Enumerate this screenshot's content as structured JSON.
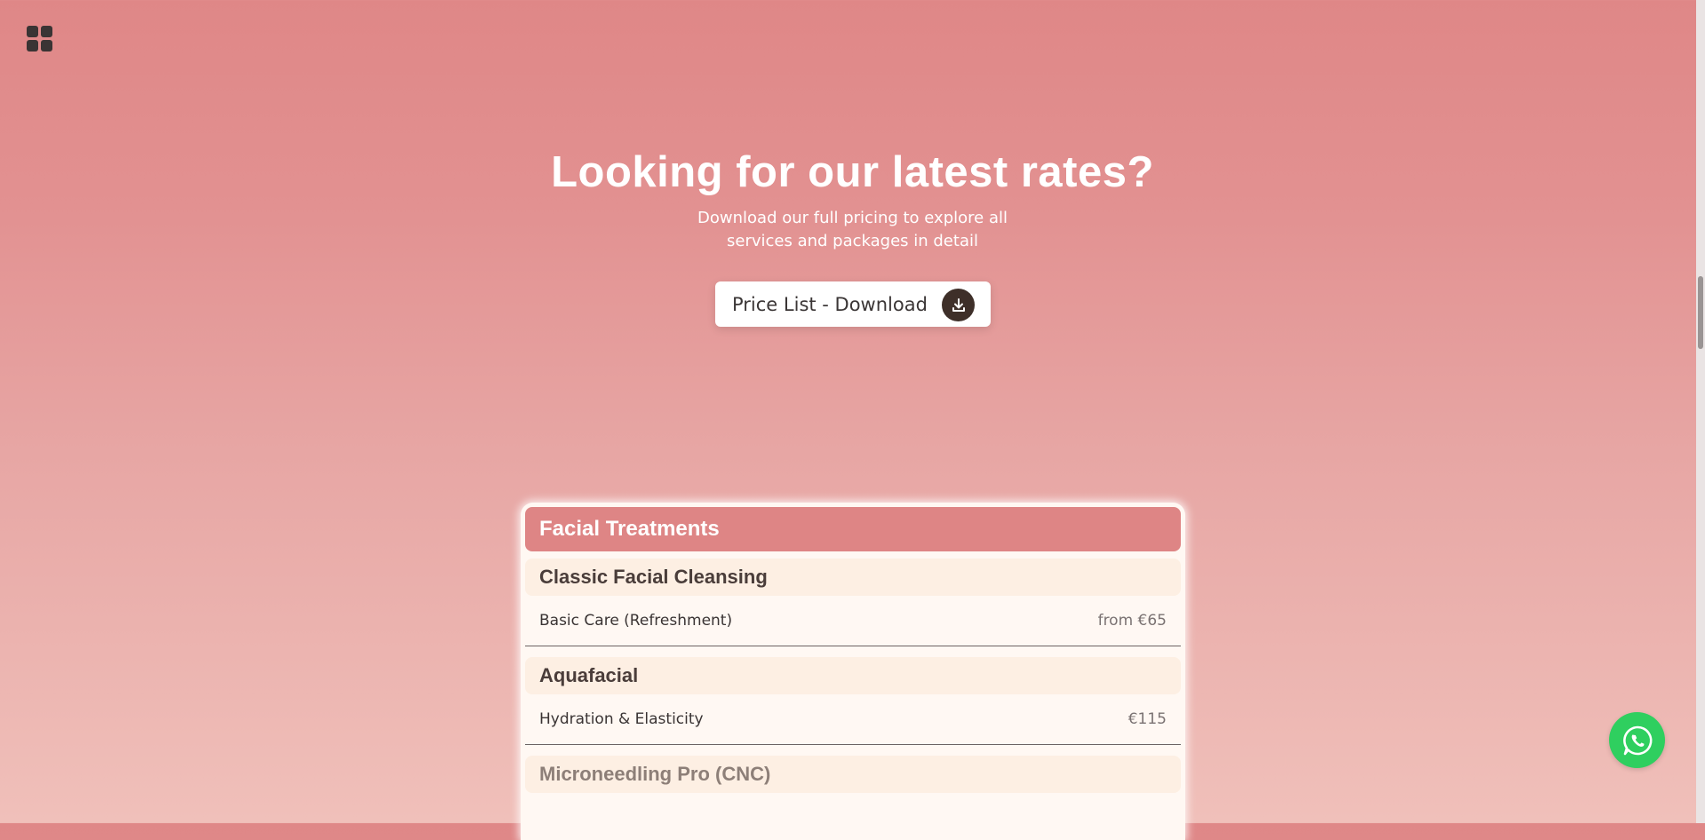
{
  "icons": {
    "menu": "grid-menu-icon",
    "download": "download-icon",
    "whatsapp": "whatsapp-icon"
  },
  "hero": {
    "title": "Looking for our latest rates?",
    "subtitle": "Download our full pricing to explore all services and packages in detail",
    "button_label": "Price List - Download"
  },
  "pricing": {
    "category": "Facial Treatments",
    "groups": [
      {
        "title": "Classic Facial Cleansing",
        "items": [
          {
            "name": "Basic Care (Refreshment)",
            "price": "from €65"
          }
        ]
      },
      {
        "title": "Aquafacial",
        "items": [
          {
            "name": "Hydration & Elasticity",
            "price": "€115"
          }
        ]
      },
      {
        "title": "Microneedling Pro (CNC)",
        "items": []
      }
    ]
  },
  "colors": {
    "background_top": "#df8787",
    "background_bottom": "#f0c0ba",
    "category_header": "#de8585",
    "group_header": "#fdefe3",
    "whatsapp": "#2fcf5f",
    "download_icon_bg": "#3e2f29"
  }
}
